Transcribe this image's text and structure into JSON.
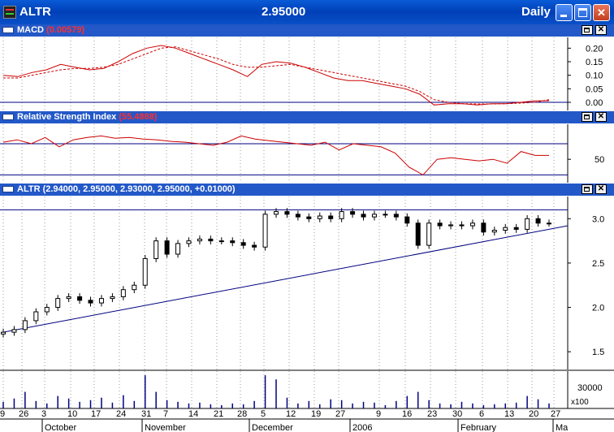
{
  "window": {
    "symbol": "ALTR",
    "price": "2.95000",
    "period": "Daily",
    "minimize_icon": "minimize-icon",
    "maximize_icon": "maximize-icon",
    "close_icon": "close-icon"
  },
  "panels": {
    "macd": {
      "label": "MACD",
      "value": "(0.00579)",
      "line_color": "#cc0000"
    },
    "rsi": {
      "label": "Relative Strength Index",
      "value": "(55.4888)",
      "line_color": "#cc0000"
    },
    "price": {
      "label": "ALTR",
      "value": "(2.94000, 2.95000, 2.93000, 2.95000, +0.01000)",
      "trendline_color": "#000080"
    },
    "volume": {
      "bar_color": "#000080"
    }
  },
  "axes": {
    "macd_ticks": [
      "0.20",
      "0.15",
      "0.10",
      "0.05",
      "0.00"
    ],
    "rsi_ticks": [
      "50"
    ],
    "price_ticks": [
      "3.0",
      "2.5",
      "2.0",
      "1.5"
    ],
    "volume_ticks": [
      "30000",
      "x100"
    ],
    "day_ticks": [
      "9",
      "26",
      "3",
      "10",
      "17",
      "24",
      "31",
      "7",
      "14",
      "21",
      "28",
      "5",
      "12",
      "19",
      "27",
      "9",
      "16",
      "23",
      "30",
      "6",
      "13",
      "20",
      "27"
    ],
    "month_labels": [
      "October",
      "November",
      "December",
      "2006",
      "February",
      "Ma"
    ]
  },
  "chart_data": [
    {
      "type": "line",
      "title": "MACD",
      "ylim": [
        -0.03,
        0.24
      ],
      "series": [
        {
          "name": "MACD",
          "values": [
            0.1,
            0.095,
            0.11,
            0.12,
            0.14,
            0.13,
            0.12,
            0.125,
            0.15,
            0.18,
            0.2,
            0.21,
            0.2,
            0.18,
            0.16,
            0.14,
            0.12,
            0.095,
            0.14,
            0.15,
            0.145,
            0.13,
            0.11,
            0.09,
            0.08,
            0.08,
            0.07,
            0.06,
            0.05,
            0.03,
            -0.01,
            -0.005,
            -0.005,
            -0.01,
            -0.005,
            -0.005,
            0.0,
            0.005,
            0.006
          ]
        },
        {
          "name": "Signal",
          "values": [
            0.09,
            0.09,
            0.1,
            0.11,
            0.12,
            0.125,
            0.125,
            0.13,
            0.14,
            0.16,
            0.18,
            0.2,
            0.205,
            0.19,
            0.175,
            0.16,
            0.14,
            0.13,
            0.13,
            0.135,
            0.14,
            0.13,
            0.12,
            0.11,
            0.1,
            0.09,
            0.08,
            0.07,
            0.06,
            0.04,
            0.01,
            0.0,
            -0.005,
            -0.006,
            -0.006,
            -0.005,
            -0.003,
            0.0,
            0.01
          ]
        }
      ]
    },
    {
      "type": "line",
      "title": "Relative Strength Index",
      "ylim": [
        20,
        95
      ],
      "series": [
        {
          "name": "RSI",
          "values": [
            72,
            75,
            70,
            78,
            66,
            75,
            78,
            80,
            77,
            78,
            76,
            75,
            73,
            72,
            70,
            68,
            72,
            80,
            76,
            74,
            72,
            70,
            68,
            72,
            62,
            70,
            68,
            66,
            58,
            40,
            30,
            50,
            52,
            50,
            48,
            50,
            45,
            60,
            55,
            55
          ]
        }
      ]
    },
    {
      "type": "candlestick",
      "title": "ALTR",
      "ylim": [
        1.3,
        3.25
      ],
      "trendline": {
        "from": 1.72,
        "to": 2.92
      },
      "resistance": 3.1,
      "series": [
        {
          "name": "close",
          "values": [
            1.72,
            1.75,
            1.85,
            1.95,
            2.0,
            2.1,
            2.12,
            2.08,
            2.05,
            2.1,
            2.12,
            2.2,
            2.25,
            2.55,
            2.75,
            2.6,
            2.72,
            2.75,
            2.77,
            2.75,
            2.75,
            2.73,
            2.7,
            2.68,
            3.05,
            3.08,
            3.05,
            3.02,
            3.0,
            3.03,
            3.0,
            3.08,
            3.05,
            3.02,
            3.05,
            3.05,
            3.02,
            2.95,
            2.7,
            2.95,
            2.92,
            2.93,
            2.92,
            2.95,
            2.85,
            2.87,
            2.9,
            2.88,
            3.0,
            2.95,
            2.95
          ]
        }
      ]
    },
    {
      "type": "bar",
      "title": "Volume",
      "ylim": [
        0,
        450
      ],
      "series": [
        {
          "name": "Volume",
          "values": [
            80,
            120,
            200,
            90,
            60,
            150,
            120,
            80,
            100,
            130,
            70,
            160,
            90,
            400,
            200,
            100,
            80,
            60,
            70,
            50,
            40,
            60,
            50,
            90,
            400,
            350,
            130,
            60,
            90,
            50,
            110,
            100,
            60,
            80,
            70,
            40,
            90,
            150,
            200,
            100,
            60,
            50,
            80,
            60,
            40,
            50,
            60,
            70,
            150,
            110,
            60
          ]
        }
      ]
    }
  ]
}
